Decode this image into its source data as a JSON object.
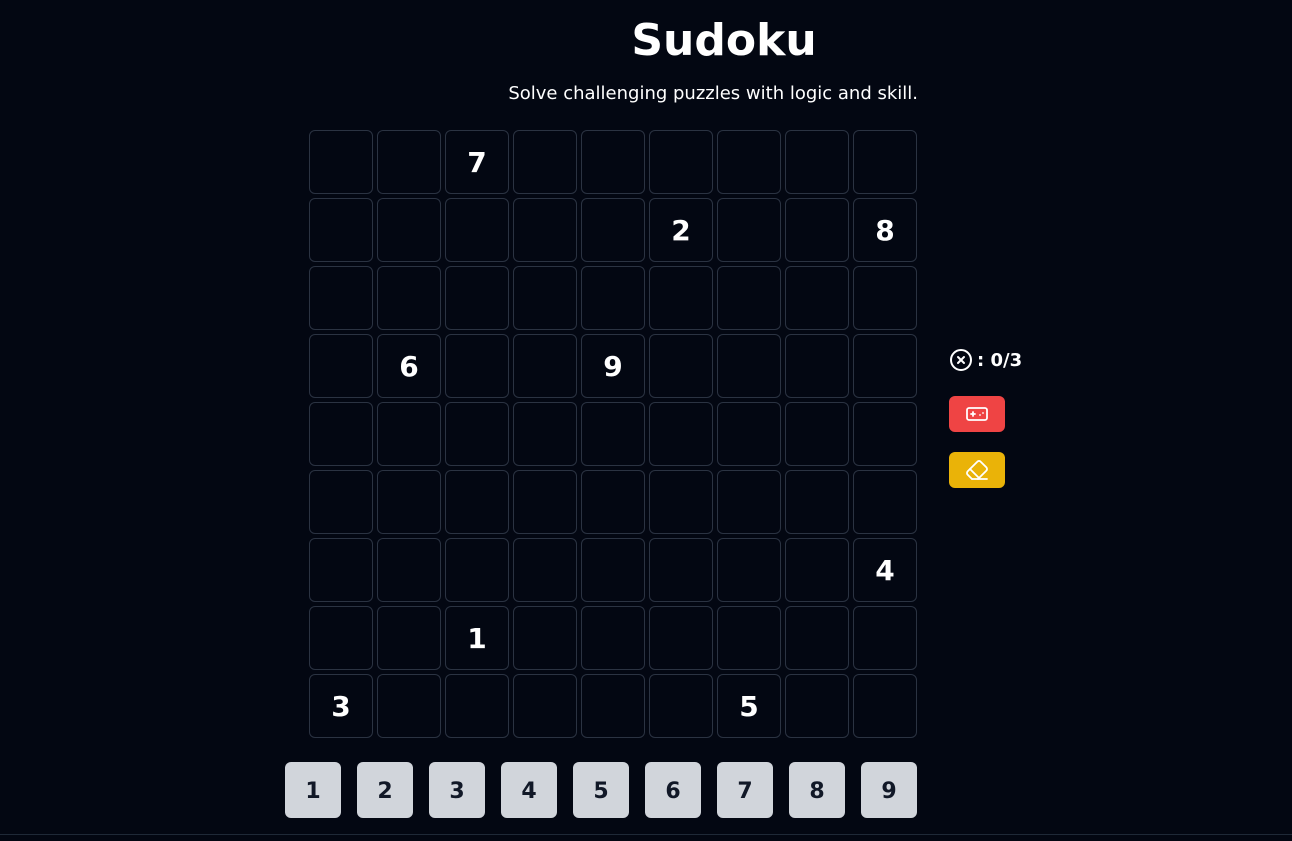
{
  "header": {
    "title": "Sudoku",
    "subtitle": "Solve challenging puzzles with logic and skill."
  },
  "board": [
    [
      "",
      "",
      "7",
      "",
      "",
      "",
      "",
      "",
      ""
    ],
    [
      "",
      "",
      "",
      "",
      "",
      "2",
      "",
      "",
      "8"
    ],
    [
      "",
      "",
      "",
      "",
      "",
      "",
      "",
      "",
      ""
    ],
    [
      "",
      "6",
      "",
      "",
      "9",
      "",
      "",
      "",
      ""
    ],
    [
      "",
      "",
      "",
      "",
      "",
      "",
      "",
      "",
      ""
    ],
    [
      "",
      "",
      "",
      "",
      "",
      "",
      "",
      "",
      ""
    ],
    [
      "",
      "",
      "",
      "",
      "",
      "",
      "",
      "",
      "4"
    ],
    [
      "",
      "",
      "1",
      "",
      "",
      "",
      "",
      "",
      ""
    ],
    [
      "3",
      "",
      "",
      "",
      "",
      "",
      "5",
      "",
      ""
    ]
  ],
  "numpad": [
    "1",
    "2",
    "3",
    "4",
    "5",
    "6",
    "7",
    "8",
    "9"
  ],
  "status": {
    "mistakes_icon": "x-circle-icon",
    "mistakes_text": ": 0/3"
  },
  "actions": {
    "new_game": {
      "icon": "gamepad-icon",
      "color": "#ef4444"
    },
    "erase": {
      "icon": "eraser-icon",
      "color": "#eab308"
    }
  },
  "colors": {
    "background": "#030712",
    "cell_border": "#2b3342",
    "numpad_bg": "#d1d5db",
    "numpad_text": "#111827"
  }
}
